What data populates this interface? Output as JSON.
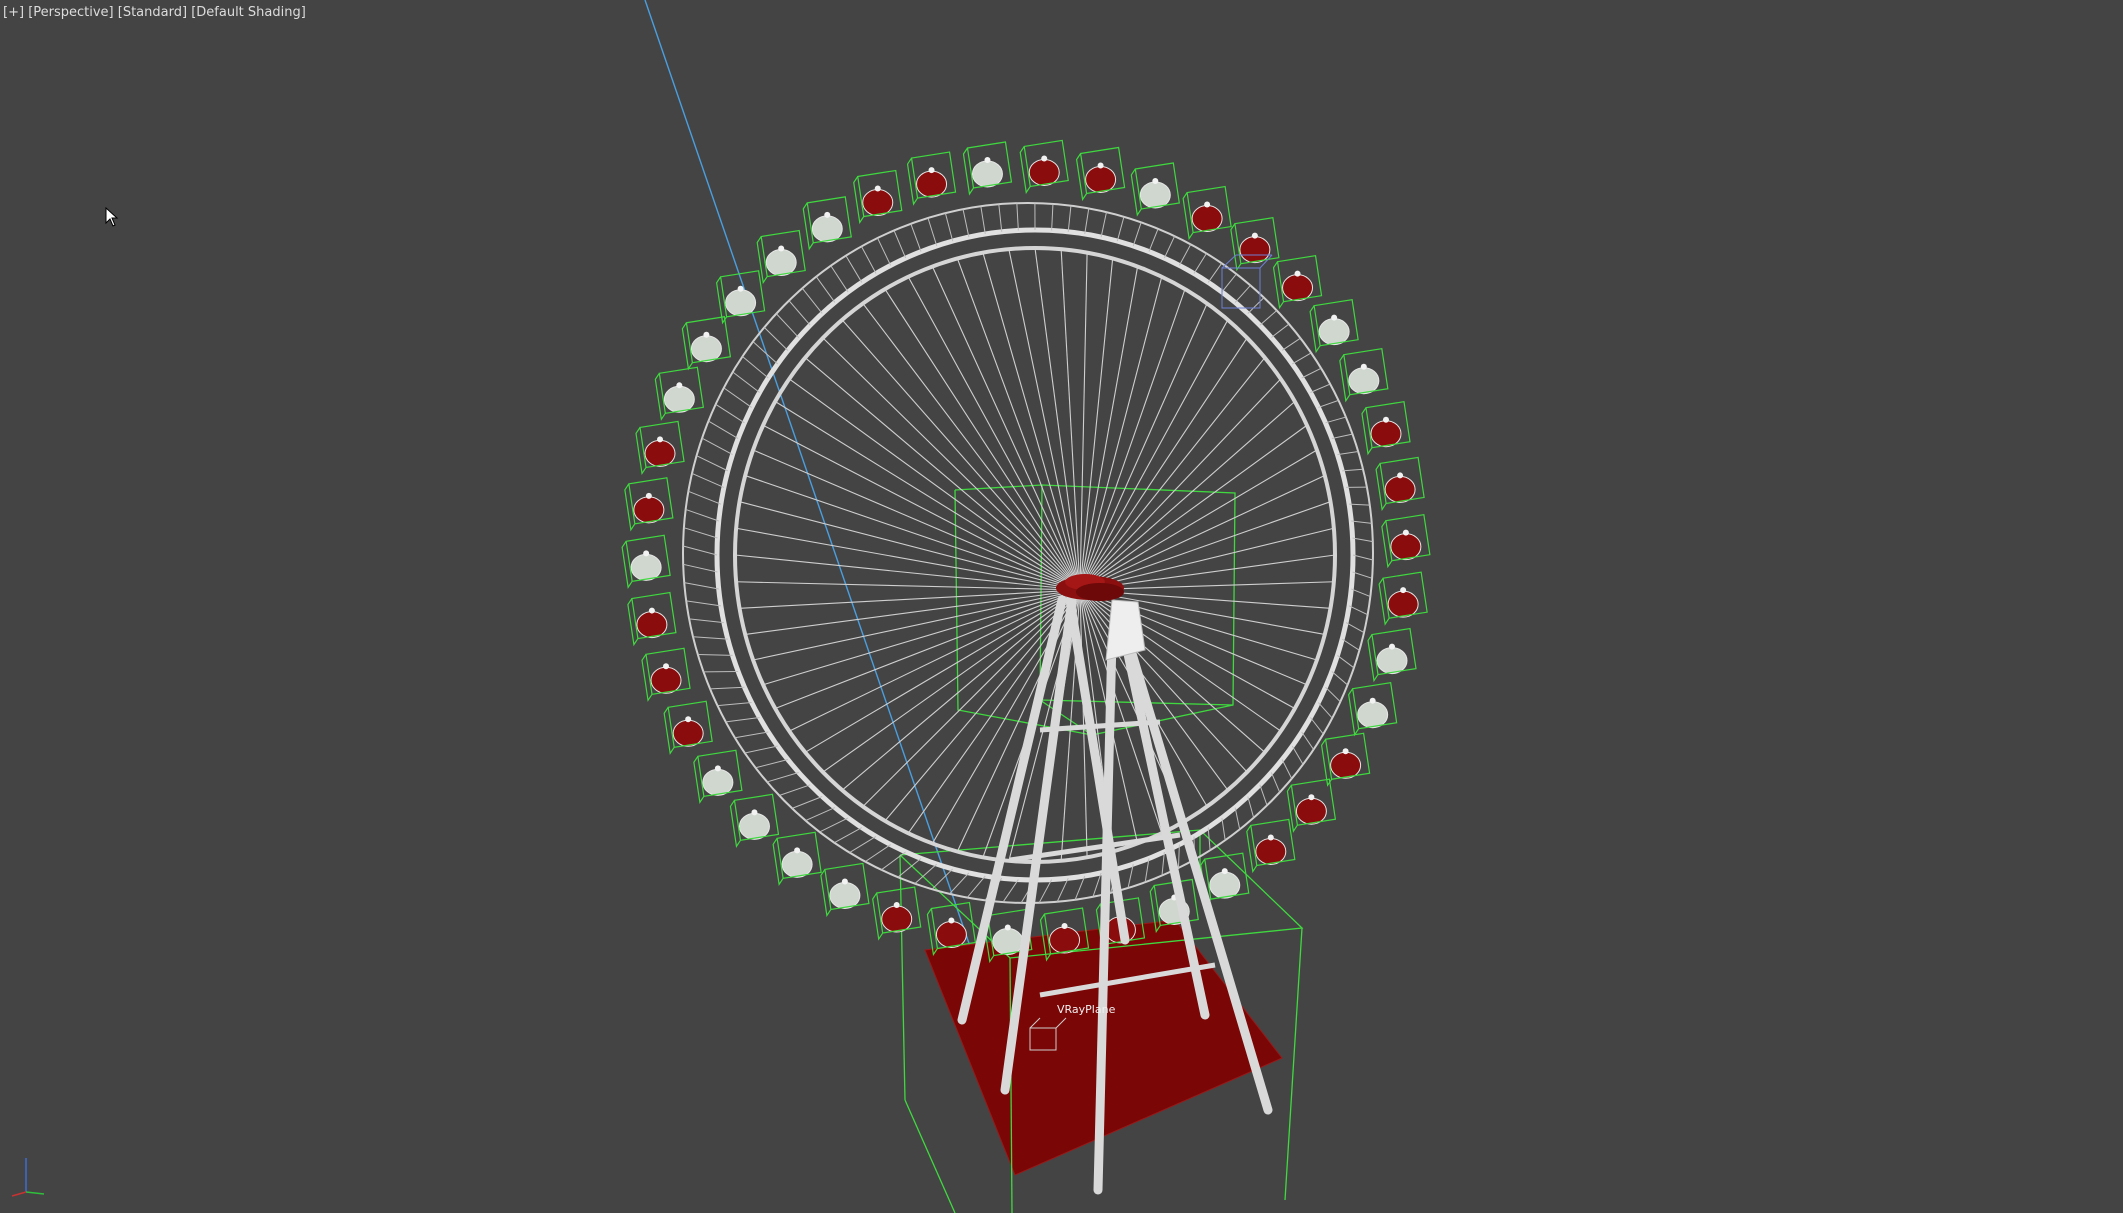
{
  "viewport": {
    "menu_plus": "[+]",
    "view_mode": "[Perspective]",
    "preset": "[Standard]",
    "shading": "[Default Shading]"
  },
  "scene": {
    "object_label": "VRayPlane",
    "ring_cabin_count": 42,
    "spoke_count": 72
  },
  "colors": {
    "background": "#444444",
    "selection": "#3fd93f",
    "frame": "#d8d8d8",
    "cabin_red": "#8a0c0c",
    "plane_red": "#7a0606",
    "camera_line": "#4a9fe0"
  },
  "icons": {
    "cursor": "mouse-pointer-icon",
    "gizmo": "xyz-axis-icon"
  }
}
